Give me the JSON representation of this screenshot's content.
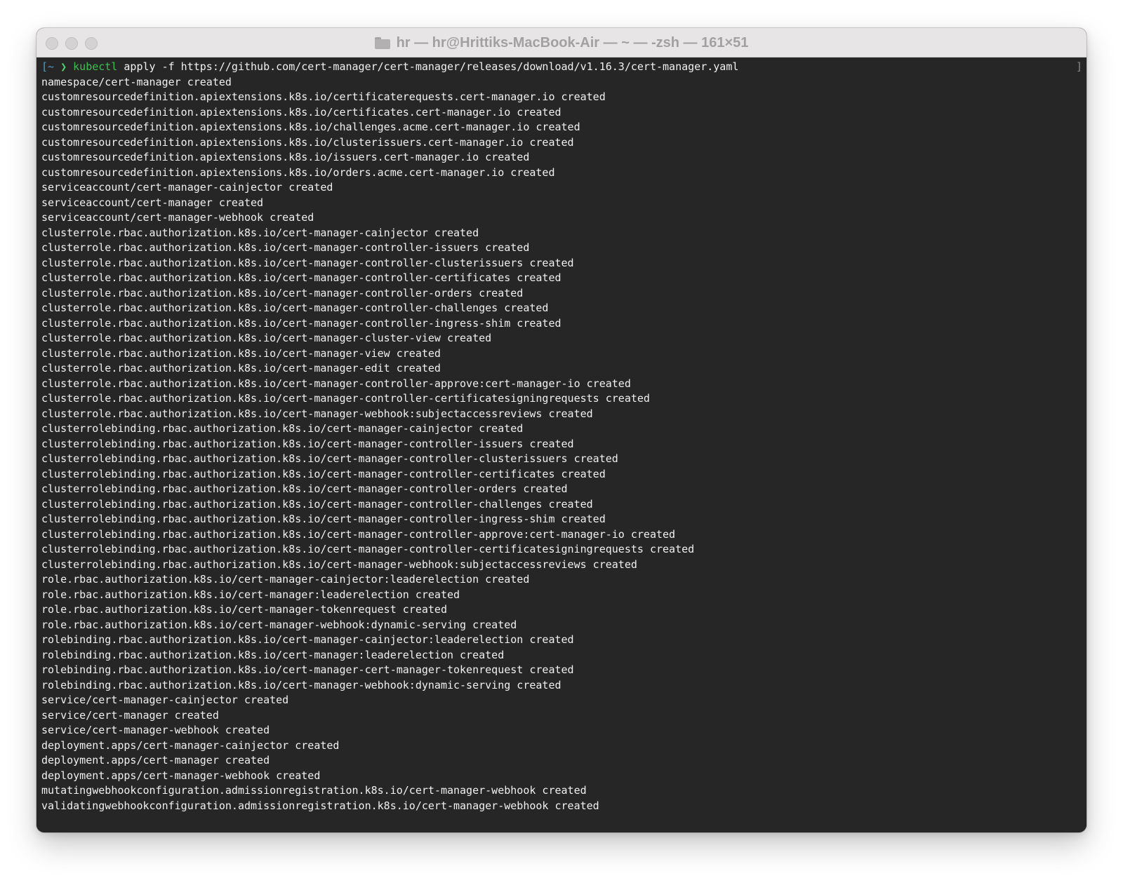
{
  "window": {
    "title": "hr — hr@Hrittiks-MacBook-Air — ~ — -zsh — 161×51",
    "folder_icon": "folder-icon",
    "traffic_lights": [
      "close-button",
      "minimize-button",
      "zoom-button"
    ]
  },
  "terminal": {
    "prompt": {
      "open_bracket": "[",
      "dir": "~",
      "symbol": "❯",
      "command": "kubectl",
      "args": "apply -f https://github.com/cert-manager/cert-manager/releases/download/v1.16.3/cert-manager.yaml",
      "close_bracket": "]"
    },
    "output": [
      "namespace/cert-manager created",
      "customresourcedefinition.apiextensions.k8s.io/certificaterequests.cert-manager.io created",
      "customresourcedefinition.apiextensions.k8s.io/certificates.cert-manager.io created",
      "customresourcedefinition.apiextensions.k8s.io/challenges.acme.cert-manager.io created",
      "customresourcedefinition.apiextensions.k8s.io/clusterissuers.cert-manager.io created",
      "customresourcedefinition.apiextensions.k8s.io/issuers.cert-manager.io created",
      "customresourcedefinition.apiextensions.k8s.io/orders.acme.cert-manager.io created",
      "serviceaccount/cert-manager-cainjector created",
      "serviceaccount/cert-manager created",
      "serviceaccount/cert-manager-webhook created",
      "clusterrole.rbac.authorization.k8s.io/cert-manager-cainjector created",
      "clusterrole.rbac.authorization.k8s.io/cert-manager-controller-issuers created",
      "clusterrole.rbac.authorization.k8s.io/cert-manager-controller-clusterissuers created",
      "clusterrole.rbac.authorization.k8s.io/cert-manager-controller-certificates created",
      "clusterrole.rbac.authorization.k8s.io/cert-manager-controller-orders created",
      "clusterrole.rbac.authorization.k8s.io/cert-manager-controller-challenges created",
      "clusterrole.rbac.authorization.k8s.io/cert-manager-controller-ingress-shim created",
      "clusterrole.rbac.authorization.k8s.io/cert-manager-cluster-view created",
      "clusterrole.rbac.authorization.k8s.io/cert-manager-view created",
      "clusterrole.rbac.authorization.k8s.io/cert-manager-edit created",
      "clusterrole.rbac.authorization.k8s.io/cert-manager-controller-approve:cert-manager-io created",
      "clusterrole.rbac.authorization.k8s.io/cert-manager-controller-certificatesigningrequests created",
      "clusterrole.rbac.authorization.k8s.io/cert-manager-webhook:subjectaccessreviews created",
      "clusterrolebinding.rbac.authorization.k8s.io/cert-manager-cainjector created",
      "clusterrolebinding.rbac.authorization.k8s.io/cert-manager-controller-issuers created",
      "clusterrolebinding.rbac.authorization.k8s.io/cert-manager-controller-clusterissuers created",
      "clusterrolebinding.rbac.authorization.k8s.io/cert-manager-controller-certificates created",
      "clusterrolebinding.rbac.authorization.k8s.io/cert-manager-controller-orders created",
      "clusterrolebinding.rbac.authorization.k8s.io/cert-manager-controller-challenges created",
      "clusterrolebinding.rbac.authorization.k8s.io/cert-manager-controller-ingress-shim created",
      "clusterrolebinding.rbac.authorization.k8s.io/cert-manager-controller-approve:cert-manager-io created",
      "clusterrolebinding.rbac.authorization.k8s.io/cert-manager-controller-certificatesigningrequests created",
      "clusterrolebinding.rbac.authorization.k8s.io/cert-manager-webhook:subjectaccessreviews created",
      "role.rbac.authorization.k8s.io/cert-manager-cainjector:leaderelection created",
      "role.rbac.authorization.k8s.io/cert-manager:leaderelection created",
      "role.rbac.authorization.k8s.io/cert-manager-tokenrequest created",
      "role.rbac.authorization.k8s.io/cert-manager-webhook:dynamic-serving created",
      "rolebinding.rbac.authorization.k8s.io/cert-manager-cainjector:leaderelection created",
      "rolebinding.rbac.authorization.k8s.io/cert-manager:leaderelection created",
      "rolebinding.rbac.authorization.k8s.io/cert-manager-cert-manager-tokenrequest created",
      "rolebinding.rbac.authorization.k8s.io/cert-manager-webhook:dynamic-serving created",
      "service/cert-manager-cainjector created",
      "service/cert-manager created",
      "service/cert-manager-webhook created",
      "deployment.apps/cert-manager-cainjector created",
      "deployment.apps/cert-manager created",
      "deployment.apps/cert-manager-webhook created",
      "mutatingwebhookconfiguration.admissionregistration.k8s.io/cert-manager-webhook created",
      "validatingwebhookconfiguration.admissionregistration.k8s.io/cert-manager-webhook created"
    ]
  },
  "colors": {
    "terminal_bg": "#262626",
    "titlebar_bg": "#e7e5e6",
    "text": "#f0f0f0",
    "prompt_blue": "#4f9bc8",
    "command_green": "#3fbf4f"
  }
}
